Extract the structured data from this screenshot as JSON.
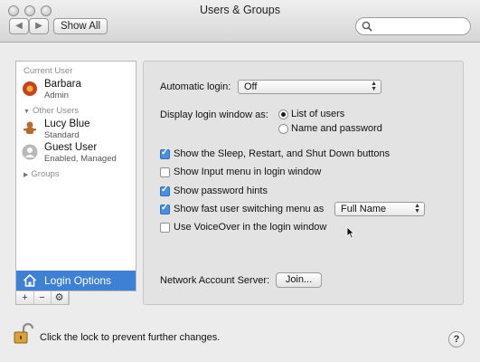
{
  "window": {
    "title": "Users & Groups"
  },
  "toolbar": {
    "back_icon": "chevron-left-icon",
    "forward_icon": "chevron-right-icon",
    "show_all_label": "Show All",
    "search_placeholder": ""
  },
  "sidebar": {
    "current_user_header": "Current User",
    "current_user": {
      "name": "Barbara",
      "role": "Admin",
      "avatar": "flower-avatar"
    },
    "other_users_header": "Other Users",
    "other_users": [
      {
        "name": "Lucy Blue",
        "role": "Standard",
        "avatar": "gingerbread-avatar"
      },
      {
        "name": "Guest User",
        "role": "Enabled, Managed",
        "avatar": "person-silhouette-avatar"
      }
    ],
    "groups_header": "Groups",
    "login_options_label": "Login Options",
    "add_label": "+",
    "remove_label": "−",
    "action_label": "⚙"
  },
  "main": {
    "automatic_login_label": "Automatic login:",
    "automatic_login_value": "Off",
    "display_window_label": "Display login window as:",
    "display_options": [
      "List of users",
      "Name and password"
    ],
    "display_selected": "List of users",
    "checkboxes": [
      {
        "label": "Show the Sleep, Restart, and Shut Down buttons",
        "checked": true
      },
      {
        "label": "Show Input menu in login window",
        "checked": false
      },
      {
        "label": "Show password hints",
        "checked": true
      },
      {
        "label": "Show fast user switching menu as",
        "checked": true
      },
      {
        "label": "Use VoiceOver in the login window",
        "checked": false
      }
    ],
    "fast_switch_value": "Full Name",
    "network_server_label": "Network Account Server:",
    "join_label": "Join..."
  },
  "footer": {
    "lock_text": "Click the lock to prevent further changes.",
    "help_label": "?"
  },
  "colors": {
    "selection": "#3d80d4",
    "checkbox_on": "#4a8fe0"
  }
}
